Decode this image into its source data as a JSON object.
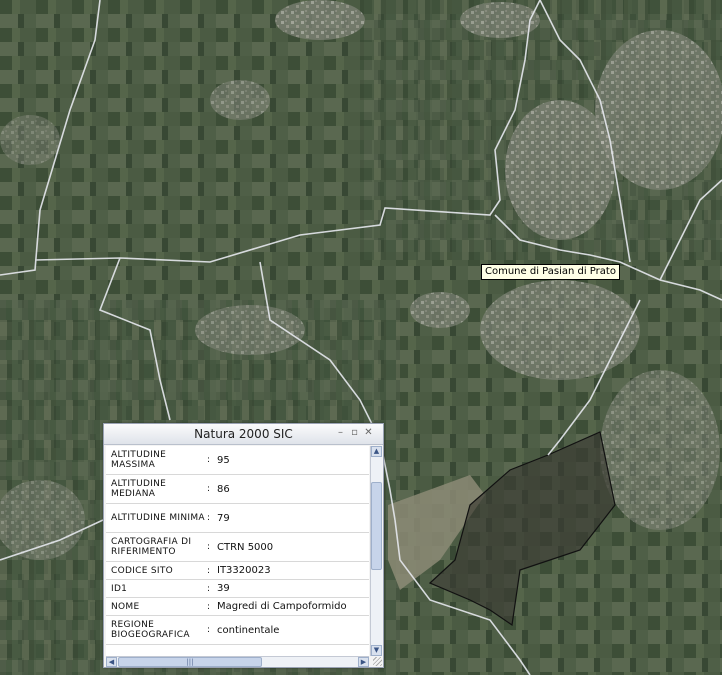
{
  "map": {
    "tooltip": "Comune di Pasian di Prato",
    "colors": {
      "imagery": "#4a5a44",
      "boundary": "#e6e8ee",
      "sic_area": "#3a3a33"
    }
  },
  "panel": {
    "title": "Natura 2000 SIC",
    "controls": [
      "minimize-icon",
      "restore-icon",
      "close-icon"
    ],
    "attributes": [
      {
        "key": "ALTITUDINE MASSIMA",
        "value": "95"
      },
      {
        "key": "ALTITUDINE MEDIANA",
        "value": "86"
      },
      {
        "key": "ALTITUDINE MINIMA",
        "value": "79"
      },
      {
        "key": "CARTOGRAFIA DI RIFERIMENTO",
        "value": "CTRN 5000"
      },
      {
        "key": "CODICE SITO",
        "value": "IT3320023"
      },
      {
        "key": "ID1",
        "value": "39"
      },
      {
        "key": "NOME",
        "value": "Magredi di Campoformido"
      },
      {
        "key": "REGIONE BIOGEOGRAFICA",
        "value": "continentale"
      }
    ]
  }
}
